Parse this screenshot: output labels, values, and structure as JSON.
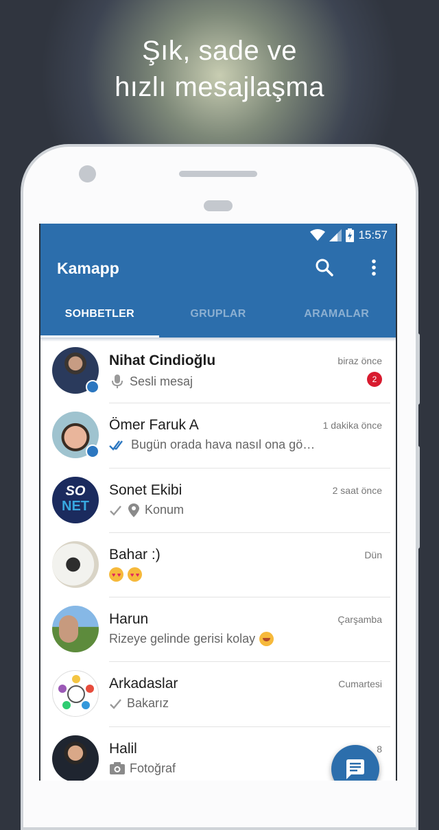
{
  "promo": {
    "line1": "Şık, sade ve",
    "line2": "hızlı mesajlaşma"
  },
  "statusbar": {
    "time": "15:57"
  },
  "app": {
    "title": "Kamapp"
  },
  "tabs": [
    {
      "label": "SOHBETLER",
      "active": true
    },
    {
      "label": "GRUPLAR",
      "active": false
    },
    {
      "label": "ARAMALAR",
      "active": false
    }
  ],
  "chats": [
    {
      "name": "Nihat Cindioğlu",
      "message": "Sesli mesaj",
      "time": "biraz önce",
      "unread": "2",
      "icon": "mic-icon",
      "online": true
    },
    {
      "name": "Ömer Faruk A",
      "message": "Bugün orada hava nasıl ona gö…",
      "time": "1 dakika önce",
      "icon": "double-check-icon",
      "online": true
    },
    {
      "name": "Sonet Ekibi",
      "message": "Konum",
      "time": "2 saat önce",
      "icon": "location-icon",
      "avatar_text_top": "SO",
      "avatar_text_bottom": "NET"
    },
    {
      "name": "Bahar :)",
      "message": "",
      "time": "Dün",
      "icon": "heart-eyes-emoji"
    },
    {
      "name": "Harun",
      "message": "Rizeye gelinde gerisi kolay",
      "time": "Çarşamba",
      "icon": "smile-emoji"
    },
    {
      "name": "Arkadaslar",
      "message": "Bakarız",
      "time": "Cumartesi",
      "icon": "check-icon"
    },
    {
      "name": "Halil",
      "message": "Fotoğraf",
      "time": "8",
      "icon": "camera-icon"
    }
  ],
  "colors": {
    "primary": "#2c6eac",
    "badge": "#d81b2f",
    "online": "#2c77c0",
    "read_ticks": "#2c77c0"
  }
}
